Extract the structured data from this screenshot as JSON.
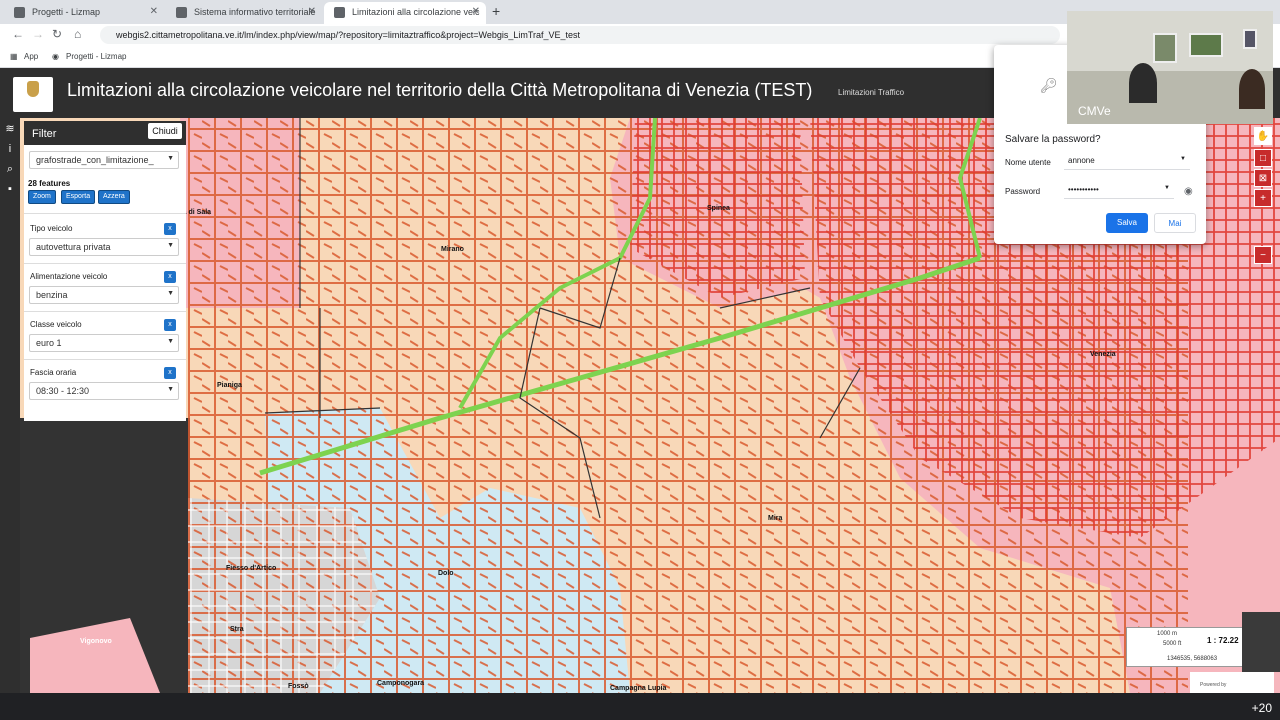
{
  "browser": {
    "tabs": [
      {
        "label": "Progetti - Lizmap",
        "active": false
      },
      {
        "label": "Sistema informativo territoriale",
        "active": false
      },
      {
        "label": "Limitazioni alla circolazione veic",
        "active": true
      }
    ],
    "url": "webgis2.cittametropolitana.ve.it/lm/index.php/view/map/?repository=limitaztraffico&project=Webgis_LimTraf_VE_test",
    "bookmarks": [
      "App",
      "Progetti - Lizmap"
    ]
  },
  "app": {
    "title": "Limitazioni alla circolazione veicolare nel territorio della Città Metropolitana di Venezia (TEST)",
    "subtitle": "Limitazioni Traffico"
  },
  "filter_panel": {
    "title": "Filter",
    "close_label": "Chiudi",
    "layer_select": "grafostrade_con_limitazione_",
    "feature_count": "28 features",
    "buttons": {
      "zoom": "Zoom",
      "export": "Esporta",
      "reset": "Azzera"
    },
    "filters": [
      {
        "label": "Tipo veicolo",
        "value": "autovettura privata"
      },
      {
        "label": "Alimentazione veicolo",
        "value": "benzina"
      },
      {
        "label": "Classe veicolo",
        "value": "euro 1"
      },
      {
        "label": "Fascia oraria",
        "value": "08:30 - 12:30"
      }
    ]
  },
  "map": {
    "place_labels": [
      "ria di Sala",
      "Mirano",
      "Spinea",
      "Venezia",
      "Pianiga",
      "Mira",
      "Fiesso d'Artico",
      "Dolo",
      "Stra",
      "Camponogara",
      "Fossò",
      "Campagna Lupia",
      "Vigonovo"
    ],
    "colors": {
      "municipality_fill": "#f8d8b8",
      "restricted_fill": "#f6b6bd",
      "exempt_fill": "#cfe9f3",
      "road_line": "#d95b30",
      "motorway_line": "#7dd34f"
    }
  },
  "scale": {
    "bar_top": "1000 m",
    "bar_bottom": "5000 ft",
    "ratio": "1 : 72.22",
    "coords": "1346535, 5688063"
  },
  "footer": {
    "powered": "Powered by",
    "participants_more": "+20"
  },
  "password_dialog": {
    "title": "Salvare la password?",
    "username_label": "Nome utente",
    "username_value": "annone",
    "password_label": "Password",
    "password_value": "•••••••••••",
    "save_label": "Salva",
    "never_label": "Mai"
  },
  "video": {
    "participant_name": "CMVe"
  }
}
